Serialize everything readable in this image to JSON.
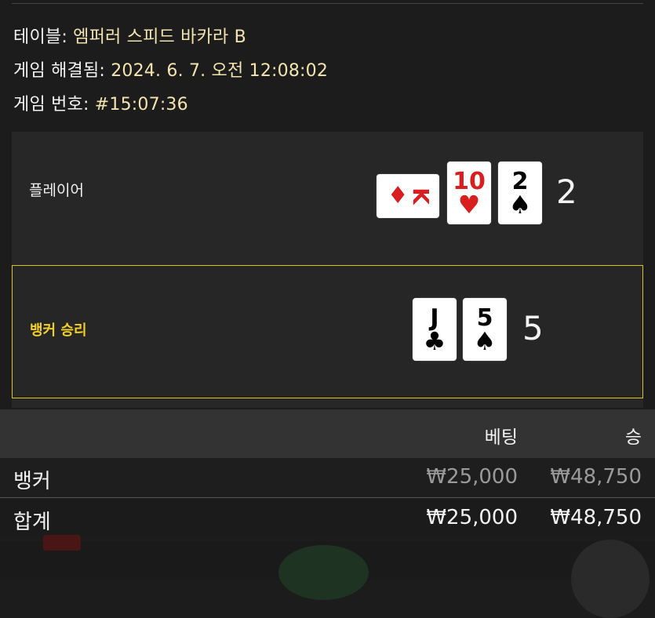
{
  "info": {
    "table_label": "테이블:",
    "table_value": "엠퍼러 스피드 바카라 B",
    "resolved_label": "게임 해결됨:",
    "resolved_value": "2024. 6. 7. 오전 12:08:02",
    "number_label": "게임 번호:",
    "number_value": "#15:07:36"
  },
  "player": {
    "label": "플레이어",
    "score": "2",
    "cards": [
      {
        "rank": "K",
        "suit": "♦",
        "color": "#d81e1e"
      },
      {
        "rank": "10",
        "suit": "♥",
        "color": "#d81e1e"
      },
      {
        "rank": "2",
        "suit": "♠",
        "color": "#000000"
      }
    ]
  },
  "banker": {
    "label": "뱅커 승리",
    "score": "5",
    "cards": [
      {
        "rank": "J",
        "suit": "♣",
        "color": "#000000"
      },
      {
        "rank": "5",
        "suit": "♠",
        "color": "#000000"
      }
    ]
  },
  "table": {
    "header_bet": "베팅",
    "header_win": "승",
    "rows": [
      {
        "name": "뱅커",
        "bet": "₩25,000",
        "win": "₩48,750"
      }
    ],
    "total": {
      "name": "합계",
      "bet": "₩25,000",
      "win": "₩48,750"
    }
  },
  "colors": {
    "accent": "#e0c21d",
    "value_text": "#f3e4b0",
    "red_suit": "#d81e1e"
  }
}
